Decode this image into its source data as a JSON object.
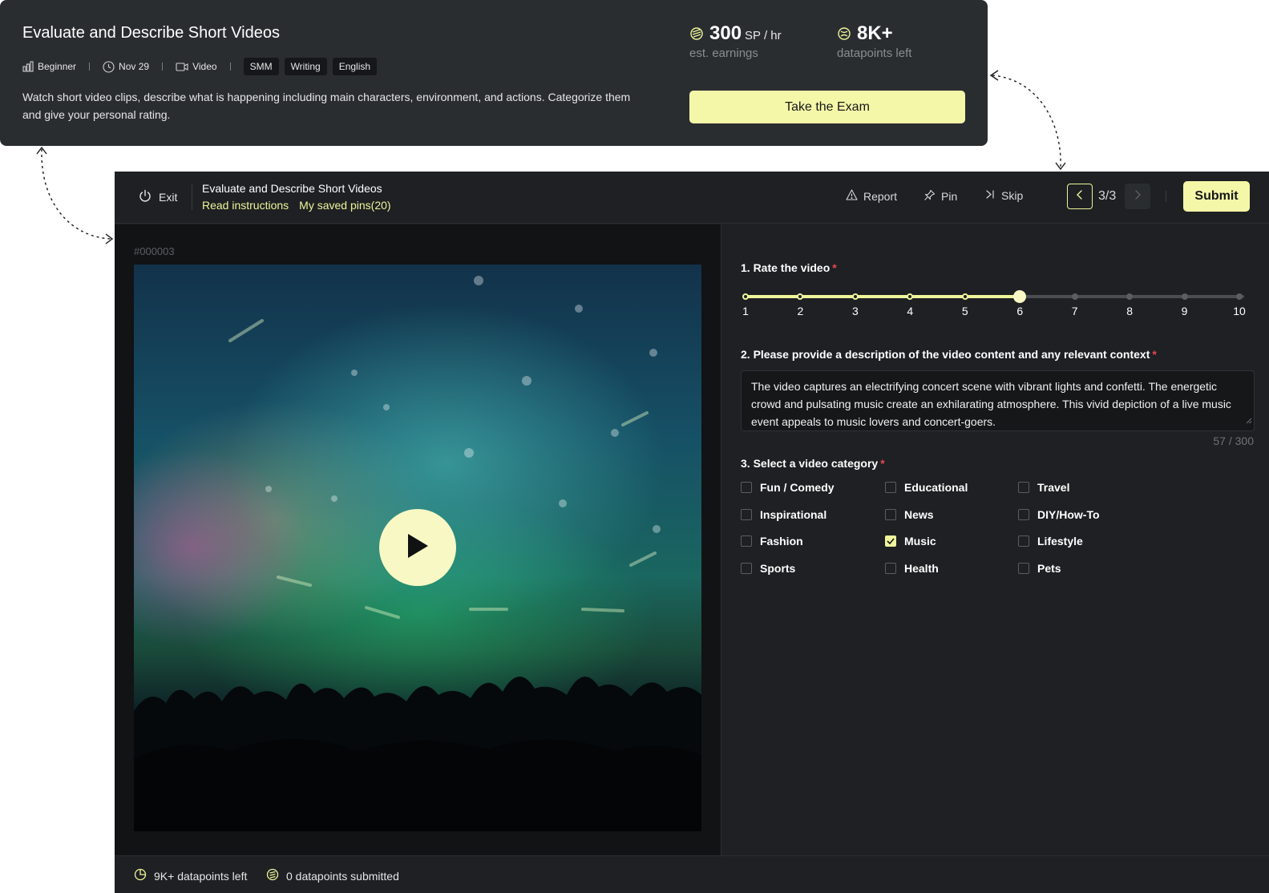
{
  "task_card": {
    "title": "Evaluate and Describe Short Videos",
    "level": "Beginner",
    "date": "Nov 29",
    "media": "Video",
    "tags": [
      "SMM",
      "Writing",
      "English"
    ],
    "description": "Watch short video clips, describe what is happening including main characters, environment, and actions. Categorize them and give your personal rating.",
    "earnings": {
      "value": "300",
      "unit": "SP / hr",
      "label": "est. earnings"
    },
    "datapoints": {
      "value": "8K+",
      "label": "datapoints left"
    },
    "cta": "Take the Exam"
  },
  "topbar": {
    "exit_label": "Exit",
    "title": "Evaluate and Describe Short Videos",
    "read_instructions": "Read instructions",
    "saved_pins": "My saved pins(20)",
    "report_label": "Report",
    "pin_label": "Pin",
    "skip_label": "Skip",
    "counter": "3/3",
    "submit_label": "Submit"
  },
  "item": {
    "id": "#000003"
  },
  "questions": {
    "rating": {
      "label": "1. Rate the video",
      "scale": [
        "1",
        "2",
        "3",
        "4",
        "5",
        "6",
        "7",
        "8",
        "9",
        "10"
      ],
      "value": 6
    },
    "description": {
      "label": "2. Please provide a description of the video content and any relevant context",
      "value": "The video captures an electrifying concert scene with vibrant lights and confetti. The energetic crowd and pulsating music create an exhilarating atmosphere. This vivid depiction of a live music event appeals to music lovers and concert-goers.",
      "counter": "57 / 300"
    },
    "category": {
      "label": "3. Select a video category",
      "options": [
        {
          "label": "Fun / Comedy",
          "checked": false
        },
        {
          "label": "Educational",
          "checked": false
        },
        {
          "label": "Travel",
          "checked": false
        },
        {
          "label": "Inspirational",
          "checked": false
        },
        {
          "label": "News",
          "checked": false
        },
        {
          "label": "DIY/How-To",
          "checked": false
        },
        {
          "label": "Fashion",
          "checked": false
        },
        {
          "label": "Music",
          "checked": true
        },
        {
          "label": "Lifestyle",
          "checked": false
        },
        {
          "label": "Sports",
          "checked": false
        },
        {
          "label": "Health",
          "checked": false
        },
        {
          "label": "Pets",
          "checked": false
        }
      ]
    }
  },
  "footer": {
    "datapoints_left": "9K+ datapoints left",
    "datapoints_submitted": "0 datapoints submitted"
  },
  "colors": {
    "accent": "#eef59a",
    "button_bg": "#f5f7a8",
    "panel_bg": "#1e2023",
    "card_bg": "#2a2d30",
    "required": "#e5484d"
  }
}
